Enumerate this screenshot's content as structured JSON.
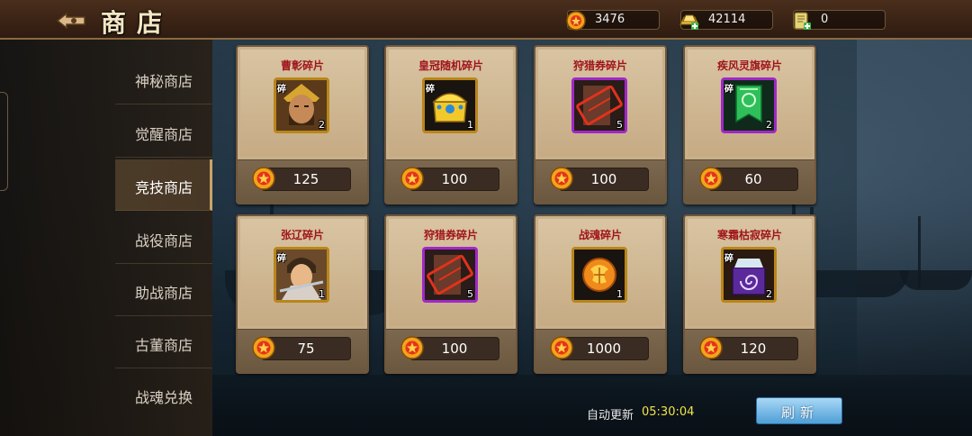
{
  "header": {
    "title": "商店",
    "resources": [
      {
        "name": "coin",
        "value": "3476"
      },
      {
        "name": "gold-ingot",
        "value": "42114"
      },
      {
        "name": "scroll",
        "value": "0"
      }
    ]
  },
  "sidebar": {
    "items": [
      {
        "label": "神秘商店",
        "active": false
      },
      {
        "label": "觉醒商店",
        "active": false
      },
      {
        "label": "竞技商店",
        "active": true
      },
      {
        "label": "战役商店",
        "active": false
      },
      {
        "label": "助战商店",
        "active": false
      },
      {
        "label": "古董商店",
        "active": false
      },
      {
        "label": "战魂兑换",
        "active": false
      }
    ]
  },
  "shop": {
    "items": [
      {
        "name": "曹彰碎片",
        "count": "2",
        "price": "125",
        "fragment": "碎",
        "icon": "warrior-portrait-icon",
        "frame": "gold"
      },
      {
        "name": "皇冠随机碎片",
        "count": "1",
        "price": "100",
        "fragment": "碎",
        "icon": "treasure-chest-icon",
        "frame": "gold"
      },
      {
        "name": "狩猎券碎片",
        "count": "5",
        "price": "100",
        "fragment": "",
        "icon": "ticket-stamp-icon",
        "frame": "purple"
      },
      {
        "name": "疾风灵旗碎片",
        "count": "2",
        "price": "60",
        "fragment": "碎",
        "icon": "green-banner-icon",
        "frame": "purple"
      },
      {
        "name": "张辽碎片",
        "count": "1",
        "price": "75",
        "fragment": "碎",
        "icon": "warrior-portrait-icon",
        "frame": "gold"
      },
      {
        "name": "狩猎券碎片",
        "count": "5",
        "price": "100",
        "fragment": "",
        "icon": "ticket-stamp-icon",
        "frame": "purple"
      },
      {
        "name": "战魂碎片",
        "count": "1",
        "price": "1000",
        "fragment": "",
        "icon": "war-soul-orb-icon",
        "frame": "gold"
      },
      {
        "name": "寒霜枯寂碎片",
        "count": "2",
        "price": "120",
        "fragment": "碎",
        "icon": "frost-spiral-icon",
        "frame": "gold"
      }
    ]
  },
  "footer": {
    "auto_refresh_label": "自动更新",
    "auto_refresh_time": "05:30:04",
    "refresh_label": "刷新"
  },
  "colors": {
    "title": "#f4e6c4",
    "item_name": "#a0141c",
    "timer": "#f2e34a",
    "refresh_button": "#4f9fd6",
    "gold_frame": "#b9861a",
    "purple_frame": "#a028c8"
  }
}
